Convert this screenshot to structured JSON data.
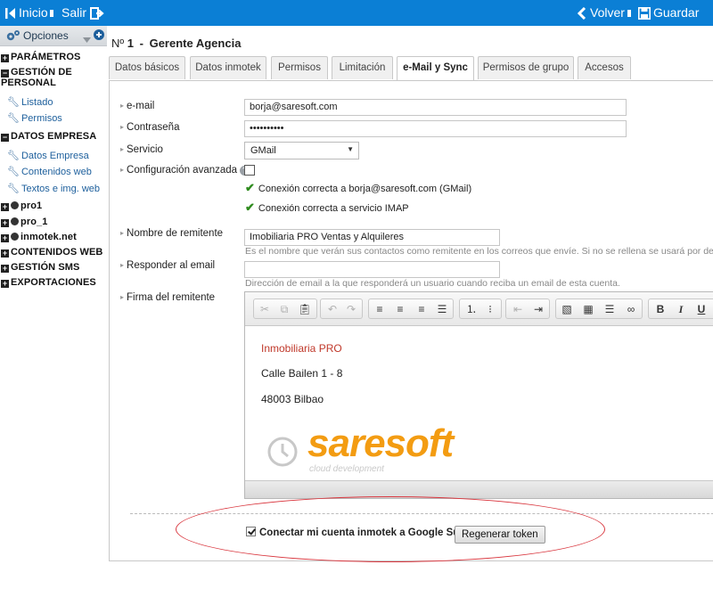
{
  "topbar": {
    "home_label": "Inicio",
    "logout_label": "Salir",
    "back_label": "Volver",
    "save_label": "Guardar"
  },
  "sidebar": {
    "options_label": "Opciones",
    "sections": [
      {
        "label": "PARÁMETROS",
        "expanded": false
      },
      {
        "label": "GESTIÓN DE PERSONAL",
        "label_line1": "GESTIÓN DE",
        "label_line2": "PERSONAL",
        "expanded": true,
        "items": [
          "Listado",
          "Permisos"
        ]
      },
      {
        "label": "DATOS EMPRESA",
        "expanded": true,
        "items": [
          "Datos Empresa",
          "Contenidos web",
          "Textos e img. web"
        ]
      },
      {
        "label": "pro1",
        "expanded": false,
        "globe": true
      },
      {
        "label": "pro_1",
        "expanded": false,
        "globe": true
      },
      {
        "label": "inmotek.net",
        "expanded": false,
        "globe": true
      },
      {
        "label": "CONTENIDOS WEB",
        "expanded": false
      },
      {
        "label": "GESTIÓN SMS",
        "expanded": false
      },
      {
        "label": "EXPORTACIONES",
        "expanded": false
      }
    ]
  },
  "page": {
    "number_prefix": "Nº",
    "number": "1",
    "title_sep": "-",
    "title": "Gerente Agencia"
  },
  "tabs": [
    {
      "label": "Datos básicos",
      "active": false
    },
    {
      "label": "Datos inmotek",
      "active": false
    },
    {
      "label": "Permisos",
      "active": false
    },
    {
      "label": "Limitación",
      "active": false
    },
    {
      "label": "e-Mail y Sync",
      "active": true
    },
    {
      "label": "Permisos de grupo",
      "active": false
    },
    {
      "label": "Accesos",
      "active": false
    }
  ],
  "form": {
    "email_label": "e-mail",
    "email_value": "borja@saresoft.com",
    "password_label": "Contraseña",
    "password_value": "••••••••••",
    "service_label": "Servicio",
    "service_value": "GMail",
    "advanced_label": "Configuración avanzada",
    "advanced_checked": false,
    "status_1": "Conexión correcta a borja@saresoft.com (GMail)",
    "status_2": "Conexión correcta a servicio IMAP",
    "sender_name_label": "Nombre de remitente",
    "sender_name_value": "Imobiliaria PRO Ventas y Alquileres",
    "sender_name_help": "Es el nombre que verán sus contactos como remitente en los correos que envíe. Si no se rellena se usará por defe",
    "reply_to_label": "Responder al email",
    "reply_to_value": "",
    "reply_to_help": "Dirección de email a la que responderá un usuario cuando reciba un email de esta cuenta.",
    "signature_label": "Firma del remitente"
  },
  "signature": {
    "line1": "Inmobiliaria PRO",
    "line2": "Calle Bailen 1 - 8",
    "line3": "48003 Bilbao",
    "logo_text": "saresoft",
    "logo_tagline": "cloud development",
    "line1_color": "#c0392b",
    "logo_color": "#f39c12"
  },
  "google": {
    "connect_label": "Conectar mi cuenta inmotek a Google Suite",
    "connect_checked": true,
    "regen_label": "Regenerar token"
  },
  "colors": {
    "topbar": "#0b7fd5",
    "accent": "#1d5f9c",
    "ok": "#2e8b1e",
    "highlight": "#d9363e"
  }
}
